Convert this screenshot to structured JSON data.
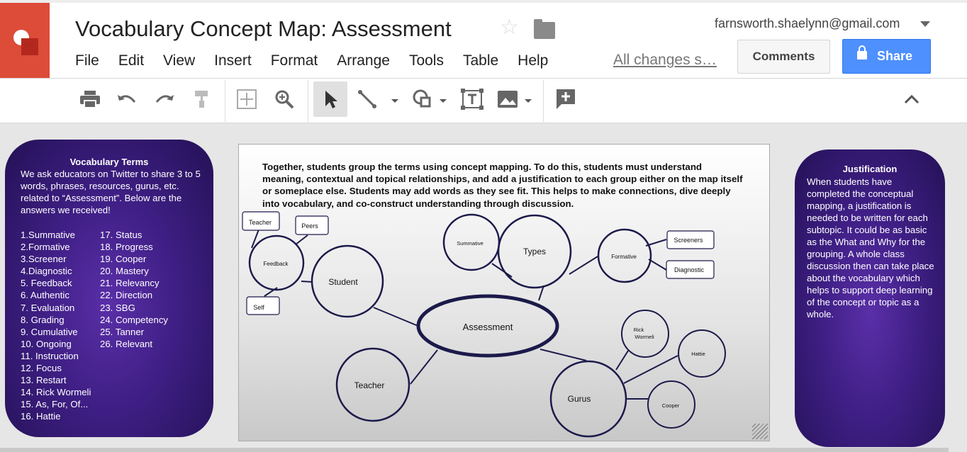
{
  "header": {
    "title": "Vocabulary Concept Map: Assessment",
    "account": "farnsworth.shaelynn@gmail.com",
    "menu": [
      "File",
      "Edit",
      "View",
      "Insert",
      "Format",
      "Arrange",
      "Tools",
      "Table",
      "Help"
    ],
    "save_status": "All changes s…",
    "comments_label": "Comments",
    "share_label": "Share"
  },
  "toolbar": {
    "icons": [
      "print-icon",
      "undo-icon",
      "redo-icon",
      "paint-format-icon",
      "zoom-fit-icon",
      "zoom-in-icon",
      "select-icon",
      "line-icon",
      "shape-icon",
      "text-box-icon",
      "image-icon",
      "comment-icon",
      "collapse-icon"
    ]
  },
  "left_panel": {
    "title": "Vocabulary Terms",
    "intro": "We ask educators on Twitter to share 3 to 5 words, phrases, resources, gurus, etc. related to “Assessment”. Below are the answers we received!",
    "col1": [
      "1.Summative",
      "2.Formative",
      "3.Screener",
      "4.Diagnostic",
      "5. Feedback",
      "6. Authentic",
      "7. Evaluation",
      "8. Grading",
      "9. Cumulative",
      "10. Ongoing",
      "11. Instruction",
      "12. Focus",
      "13. Restart",
      "14. Rick Wormeli",
      "15. As, For, Of...",
      "16. Hattie"
    ],
    "col2": [
      "17. Status",
      "18. Progress",
      "19. Cooper",
      "20. Mastery",
      "21. Relevancy",
      "22. Direction",
      "23. SBG",
      "24. Competency",
      "25. Tanner",
      "26. Relevant"
    ]
  },
  "right_panel": {
    "title": "Justification",
    "text": "When students have completed the conceptual mapping, a justification is needed to be written for each subtopic. It could be as basic as the What and Why for the grouping. A whole class discussion then can take place about the vocabulary which helps to support deep learning of the concept or topic as a whole."
  },
  "slide": {
    "intro": "Together, students group the terms using concept mapping. To do this, students must understand meaning, contextual and topical relationships, and add a justification to each group either on the map itself or someplace else. Students may add words as they see fit. This helps to make connections, dive deeply into vocabulary, and co-construct understanding through discussion.",
    "nodes": {
      "assessment": "Assessment",
      "student": "Student",
      "feedback": "Feedback",
      "teacher_box": "Teacher",
      "peers": "Peers",
      "self": "Self",
      "types": "Types",
      "summative": "Summative",
      "formative": "Formative",
      "screeners": "Screeners",
      "diagnostic": "Diagnostic",
      "teacher": "Teacher",
      "gurus": "Gurus",
      "rick_line1": "Rick",
      "rick_line2": "Wormeli",
      "hattie": "Hattie",
      "cooper": "Cooper"
    }
  },
  "colors": {
    "brand": "#dd4b39",
    "share": "#4d90fe",
    "node_stroke": "#1c1a4a",
    "panel": "#3f1f85"
  }
}
